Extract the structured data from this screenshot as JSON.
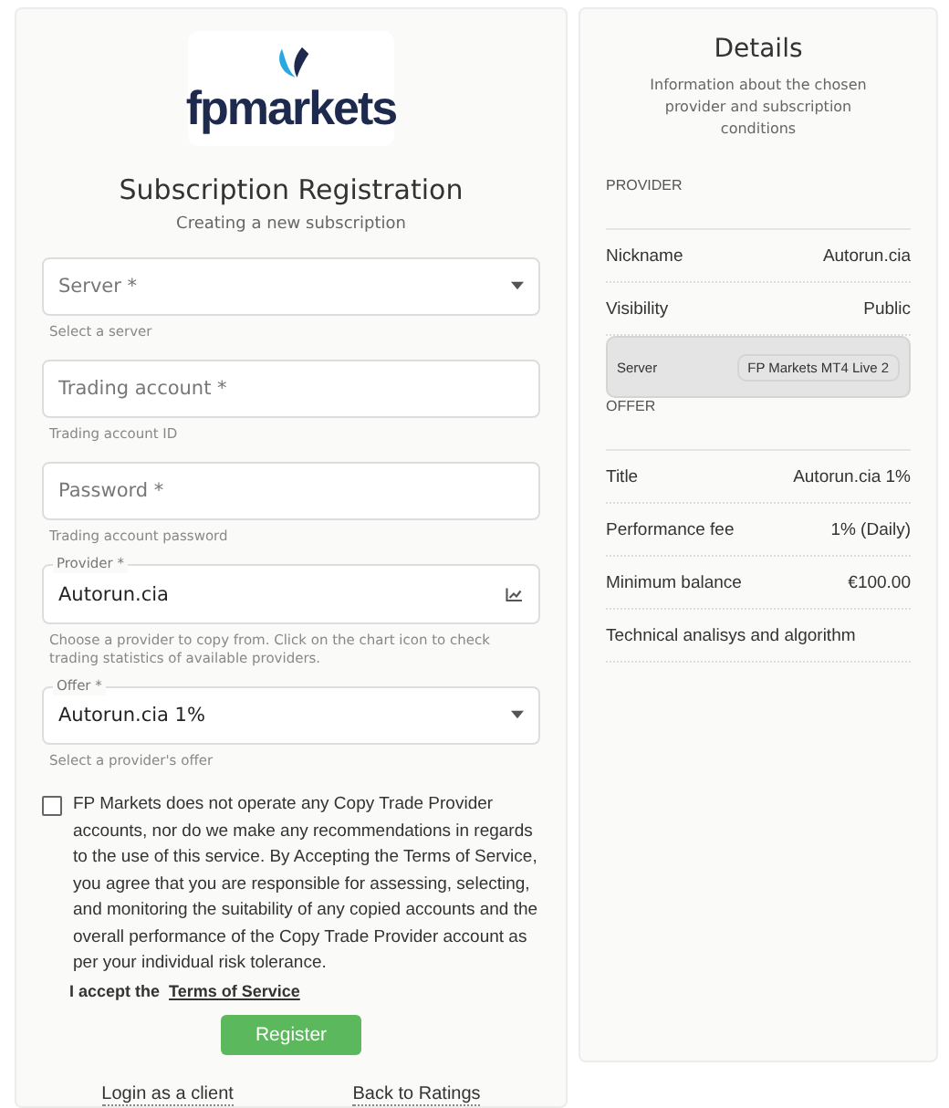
{
  "logo": {
    "text": "fpmarkets"
  },
  "form": {
    "title": "Subscription Registration",
    "subtitle": "Creating a new subscription",
    "fields": [
      {
        "kind": "select",
        "label": "Server *",
        "hint": "Select a server"
      },
      {
        "kind": "text",
        "label": "Trading account *",
        "hint": "Trading account ID"
      },
      {
        "kind": "text",
        "label": "Password *",
        "hint": "Trading account password"
      },
      {
        "kind": "provider",
        "label": "Provider *",
        "value": "Autorun.cia",
        "hint": "Choose a provider to copy from. Click on the chart icon to check trading statistics of available providers."
      },
      {
        "kind": "select",
        "label": "Offer *",
        "value": "Autorun.cia 1%",
        "hint": "Select a provider's offer"
      }
    ],
    "disclaimer": {
      "checked": false,
      "text": "FP Markets does not operate any Copy Trade Provider accounts, nor do we make any recommendations in regards to the use of this service. By Accepting the Terms of Service, you agree that you are responsible for assessing, selecting, and monitoring the suitability of any copied accounts and the overall performance of the Copy Trade Provider account as per your individual risk tolerance."
    },
    "accept": {
      "text": "I accept the",
      "link": "Terms of Service"
    },
    "submit": "Register",
    "links": [
      "Login as a client",
      "Back to Ratings"
    ]
  },
  "details": {
    "title": "Details",
    "subtitle": "Information about the chosen provider and subscription conditions",
    "rows": [
      {
        "kind": "section",
        "label": "PROVIDER"
      },
      {
        "kind": "row",
        "label": "Nickname",
        "value": "Autorun.cia"
      },
      {
        "kind": "row",
        "label": "Visibility",
        "value": "Public"
      },
      {
        "kind": "badge",
        "label": "Server",
        "value": "FP Markets MT4 Live 2"
      },
      {
        "kind": "section",
        "label": "OFFER"
      },
      {
        "kind": "row",
        "label": "Title",
        "value": "Autorun.cia 1%"
      },
      {
        "kind": "row",
        "label": "Performance fee",
        "value": "1% (Daily)"
      },
      {
        "kind": "row",
        "label": "Minimum balance",
        "value": "€100.00"
      },
      {
        "kind": "note",
        "label": "Technical analisys and algorithm"
      }
    ]
  }
}
